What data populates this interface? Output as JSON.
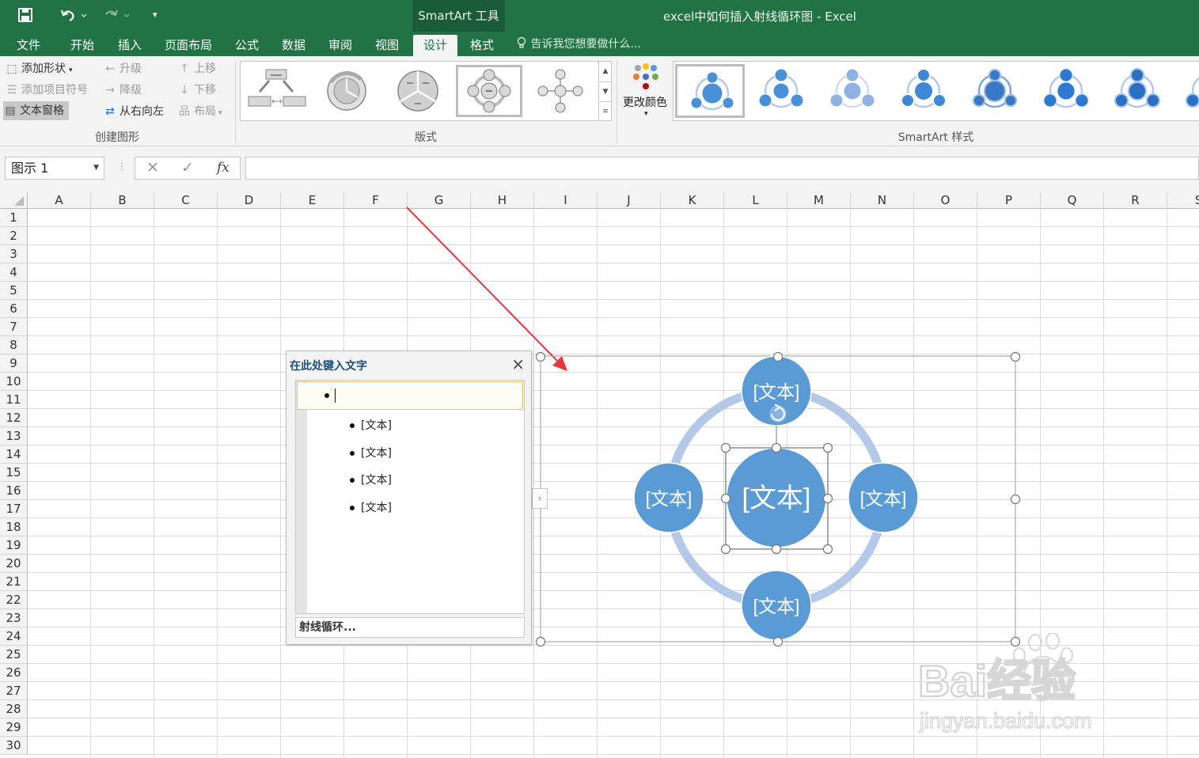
{
  "titlebar": {
    "contextual_tab": "SmartArt 工具",
    "doc_title": "excel中如何插入射线循环图 - Excel"
  },
  "tabs": [
    {
      "label": "文件"
    },
    {
      "label": "开始"
    },
    {
      "label": "插入"
    },
    {
      "label": "页面布局"
    },
    {
      "label": "公式"
    },
    {
      "label": "数据"
    },
    {
      "label": "审阅"
    },
    {
      "label": "视图"
    },
    {
      "label": "设计"
    },
    {
      "label": "格式"
    }
  ],
  "tell_me": "告诉我您想要做什么...",
  "ribbon": {
    "create": {
      "add_shape": "添加形状",
      "add_bullet": "添加项目符号",
      "text_pane": "文本窗格",
      "promote": "升级",
      "demote": "降级",
      "right_to_left": "从右向左",
      "move_up": "上移",
      "move_down": "下移",
      "layout": "布局",
      "group_label": "创建图形"
    },
    "layouts_label": "版式",
    "change_colors": "更改颜色",
    "styles_label": "SmartArt 样式"
  },
  "formula_bar": {
    "name_box": "图示 1",
    "fx": "fx",
    "value": ""
  },
  "columns": [
    "A",
    "B",
    "C",
    "D",
    "E",
    "F",
    "G",
    "H",
    "I",
    "J",
    "K",
    "L",
    "M",
    "N",
    "O",
    "P",
    "Q",
    "R",
    "S"
  ],
  "rows": [
    "1",
    "2",
    "3",
    "4",
    "5",
    "6",
    "7",
    "8",
    "9",
    "10",
    "11",
    "12",
    "13",
    "14",
    "15",
    "16",
    "17",
    "18",
    "19",
    "20",
    "21",
    "22",
    "23",
    "24",
    "25",
    "26",
    "27",
    "28",
    "29",
    "30"
  ],
  "text_pane": {
    "title": "在此处键入文字",
    "items": [
      "[文本]",
      "[文本]",
      "[文本]",
      "[文本]"
    ],
    "footer": "射线循环..."
  },
  "smartart": {
    "center_text": "[文本]",
    "node_texts": [
      "[文本]",
      "[文本]",
      "[文本]",
      "[文本]"
    ],
    "node_color": "#5b9bd5",
    "ring_color": "#b4c9e8"
  },
  "colors": {
    "excel_green": "#217346",
    "arrow_red": "#e8383d"
  },
  "watermark": {
    "brand": "Bai经验",
    "url": "jingyan.baidu.com"
  }
}
